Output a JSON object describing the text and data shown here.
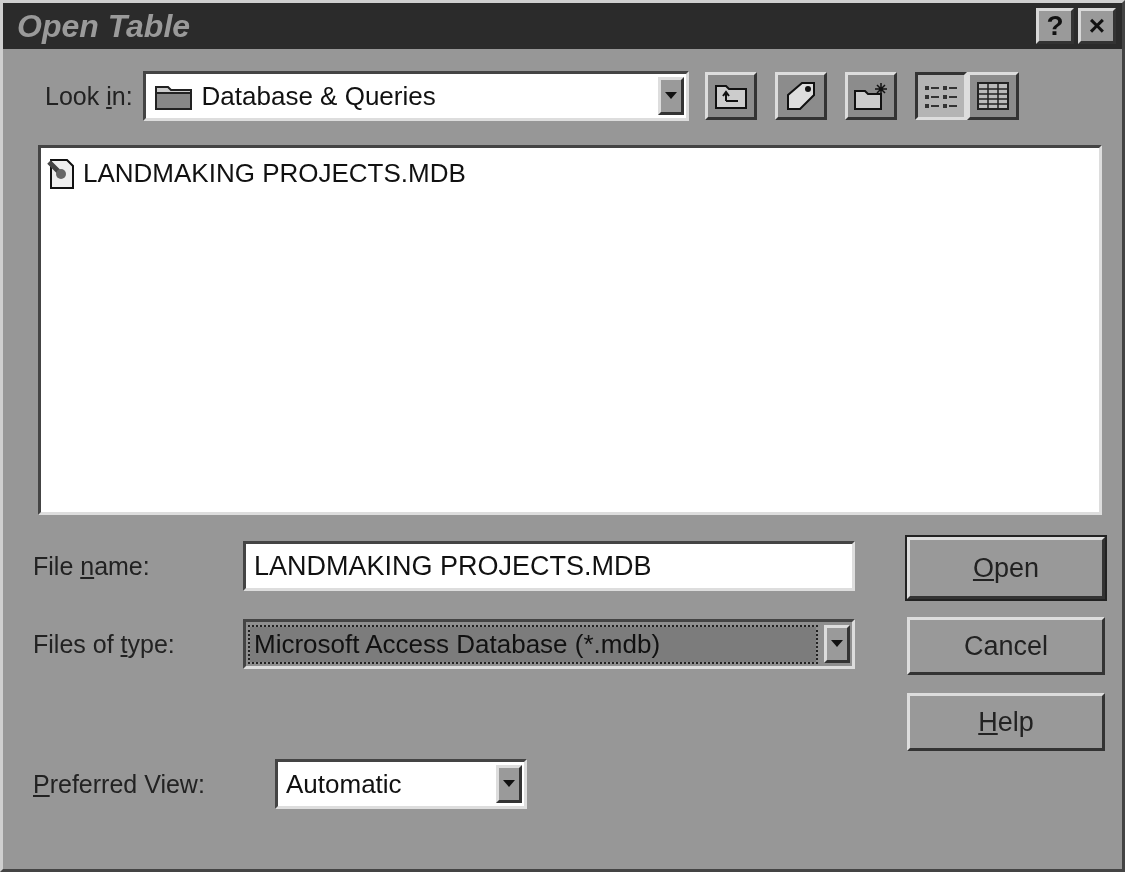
{
  "window": {
    "title": "Open Table",
    "title_buttons": [
      "?",
      "×"
    ]
  },
  "look_in": {
    "label": {
      "pre": "Look ",
      "key": "i",
      "post": "n:"
    },
    "value": "Database & Queries"
  },
  "toolbar": [
    {
      "kind": "up-folder",
      "selected": false
    },
    {
      "kind": "favorites",
      "selected": false
    },
    {
      "kind": "new-folder",
      "selected": false
    },
    {
      "kind": "list-view",
      "selected": true
    },
    {
      "kind": "details-view",
      "selected": false
    }
  ],
  "files": [
    {
      "name": "LANDMAKING PROJECTS.MDB",
      "selected": false
    }
  ],
  "file_name": {
    "label": {
      "pre": "File ",
      "key": "n",
      "post": "ame:"
    },
    "value": "LANDMAKING PROJECTS.MDB"
  },
  "file_type": {
    "label": {
      "pre": "Files of ",
      "key": "t",
      "post": "ype:"
    },
    "value": "Microsoft Access Database (*.mdb)",
    "focused": true
  },
  "preferred_view": {
    "label": {
      "key": "P",
      "post": "referred View:"
    },
    "value": "Automatic"
  },
  "buttons": [
    {
      "label": {
        "key": "O",
        "post": "pen"
      },
      "default": true
    },
    {
      "label": {
        "pre": "Cancel"
      },
      "default": false
    },
    {
      "label": {
        "key": "H",
        "post": "elp"
      },
      "default": false
    }
  ]
}
